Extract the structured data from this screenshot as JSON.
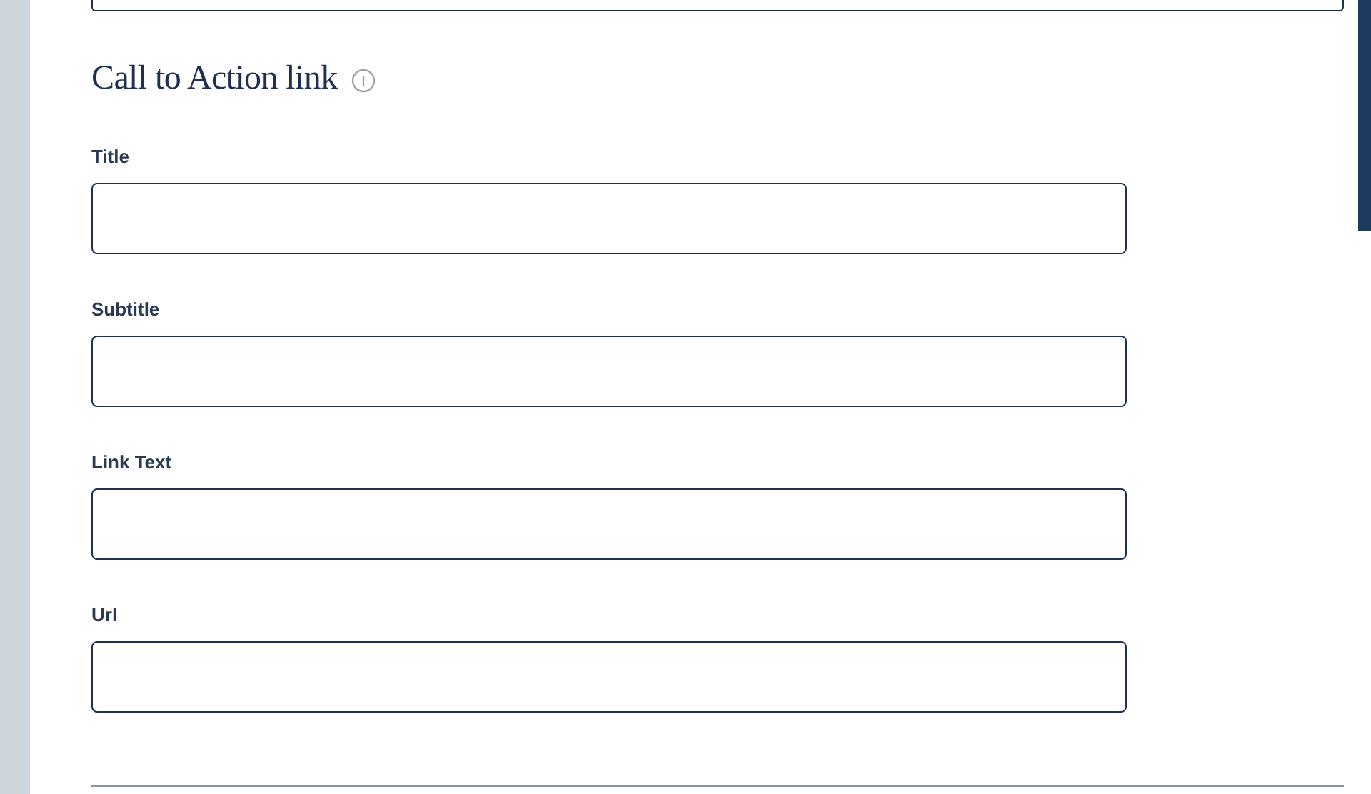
{
  "section": {
    "title": "Call to Action link"
  },
  "fields": [
    {
      "label": "Title"
    },
    {
      "label": "Subtitle"
    },
    {
      "label": "Link Text"
    },
    {
      "label": "Url"
    }
  ]
}
